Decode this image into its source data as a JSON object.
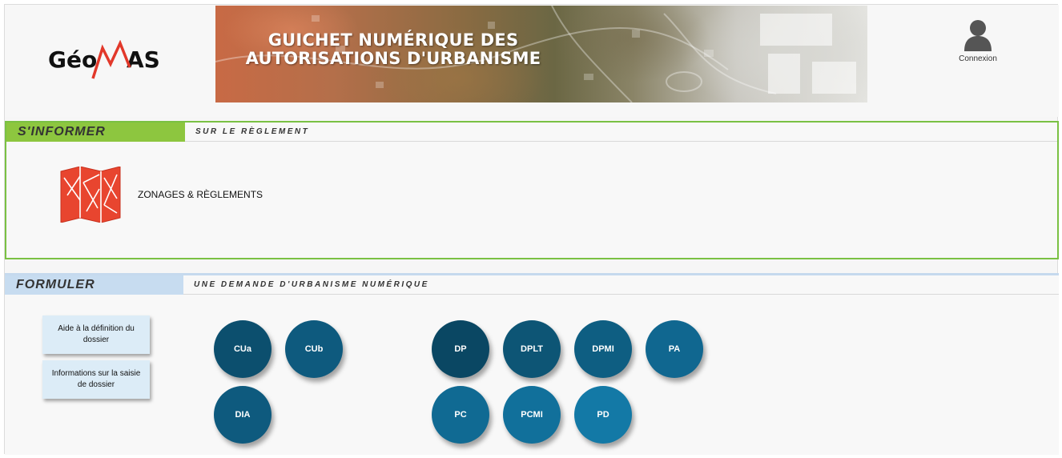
{
  "header": {
    "logo_text": "GéoMAS",
    "banner_title_line1": "GUICHET NUMÉRIQUE DES",
    "banner_title_line2": "AUTORISATIONS D'URBANISME",
    "connexion_label": "Connexion"
  },
  "informer": {
    "tab_label": "S'INFORMER",
    "subtitle": "SUR LE RÈGLEMENT",
    "zonage_label": "ZONAGES & RÈGLEMENTS",
    "zonage_icon": "map-icon"
  },
  "formuler": {
    "tab_label": "FORMULER",
    "subtitle": "UNE DEMANDE D'URBANISME NUMÉRIQUE",
    "help_buttons": [
      {
        "label": "Aide à la définition du dossier"
      },
      {
        "label": "Informations sur la saisie de dossier"
      }
    ],
    "requests": [
      {
        "label": "CUa"
      },
      {
        "label": "CUb"
      },
      {
        "label": "DIA"
      },
      {
        "label": "DP"
      },
      {
        "label": "DPLT"
      },
      {
        "label": "DPMI"
      },
      {
        "label": "PA"
      },
      {
        "label": "PC"
      },
      {
        "label": "PCMI"
      },
      {
        "label": "PD"
      }
    ]
  },
  "colors": {
    "informer_accent": "#8dc63f",
    "formuler_accent": "#c7dcf0",
    "circle_dark": "#0a4d6c",
    "circle_mid": "#0e5f84",
    "circle_light": "#1275a0",
    "logo_red": "#e2382a"
  }
}
